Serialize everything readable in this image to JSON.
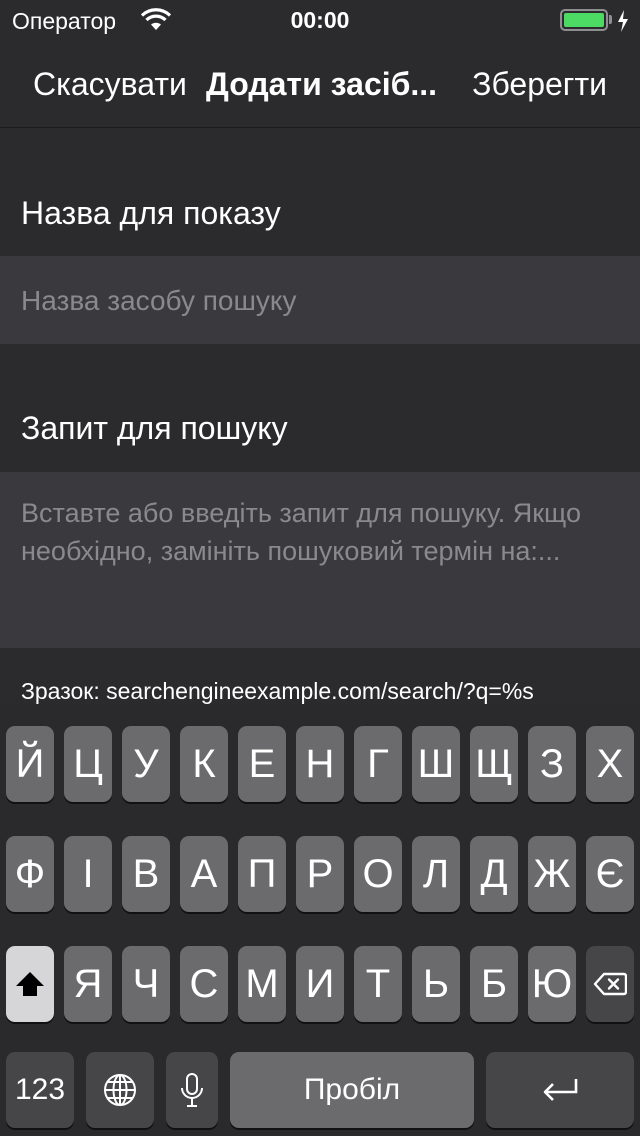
{
  "status_bar": {
    "carrier": "Оператор",
    "time": "00:00",
    "battery_level": 1.0,
    "battery_color": "#4cd964"
  },
  "nav": {
    "cancel_label": "Скасувати",
    "title": "Додати засіб...",
    "save_label": "Зберегти"
  },
  "form": {
    "name_label": "Назва для показу",
    "name_placeholder": "Назва засобу пошуку",
    "query_label": "Запит для пошуку",
    "query_placeholder_line1": "Вставте або введіть запит для пошуку. Якщо",
    "query_placeholder_line2": "необхідно, замініть пошуковий термін на:...",
    "example": "Зразок: searchengineexample.com/search/?q=%s"
  },
  "keyboard": {
    "row1": [
      "Й",
      "Ц",
      "У",
      "К",
      "Е",
      "Н",
      "Г",
      "Ш",
      "Щ",
      "З",
      "Х"
    ],
    "row2": [
      "Ф",
      "І",
      "В",
      "А",
      "П",
      "Р",
      "О",
      "Л",
      "Д",
      "Ж",
      "Є"
    ],
    "row3": [
      "Я",
      "Ч",
      "С",
      "М",
      "И",
      "Т",
      "Ь",
      "Б",
      "Ю"
    ],
    "numbers_label": "123",
    "space_label": "Пробіл",
    "icons": {
      "shift": "shift-icon",
      "delete": "backspace-icon",
      "globe": "globe-icon",
      "mic": "microphone-icon",
      "return": "return-icon"
    }
  }
}
